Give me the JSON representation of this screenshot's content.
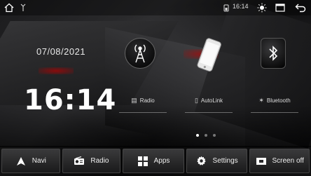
{
  "status_bar": {
    "time": "16:14",
    "icons": [
      "home-icon",
      "antenna-icon",
      "signal-icon",
      "brightness-icon",
      "window-icon",
      "back-icon"
    ]
  },
  "clock": {
    "date": "07/08/2021",
    "time": "16:14"
  },
  "tiles": [
    {
      "id": "radio",
      "label": "Radio",
      "icon": "radio-tower-icon"
    },
    {
      "id": "autolink",
      "label": "AutoLink",
      "icon": "phone-icon"
    },
    {
      "id": "bluetooth",
      "label": "Bluetooth",
      "icon": "bluetooth-icon"
    }
  ],
  "pager": {
    "count": 3,
    "active": 0
  },
  "dock": [
    {
      "id": "navi",
      "label": "Navi",
      "icon": "navigation-arrow-icon"
    },
    {
      "id": "radio",
      "label": "Radio",
      "icon": "radio-icon"
    },
    {
      "id": "apps",
      "label": "Apps",
      "icon": "apps-grid-icon"
    },
    {
      "id": "settings",
      "label": "Settings",
      "icon": "gear-icon"
    },
    {
      "id": "screenoff",
      "label": "Screen off",
      "icon": "screen-off-icon"
    }
  ],
  "colors": {
    "accent_red": "#b00000",
    "text": "#ffffff",
    "dock_bg": "#2a2a2c"
  }
}
